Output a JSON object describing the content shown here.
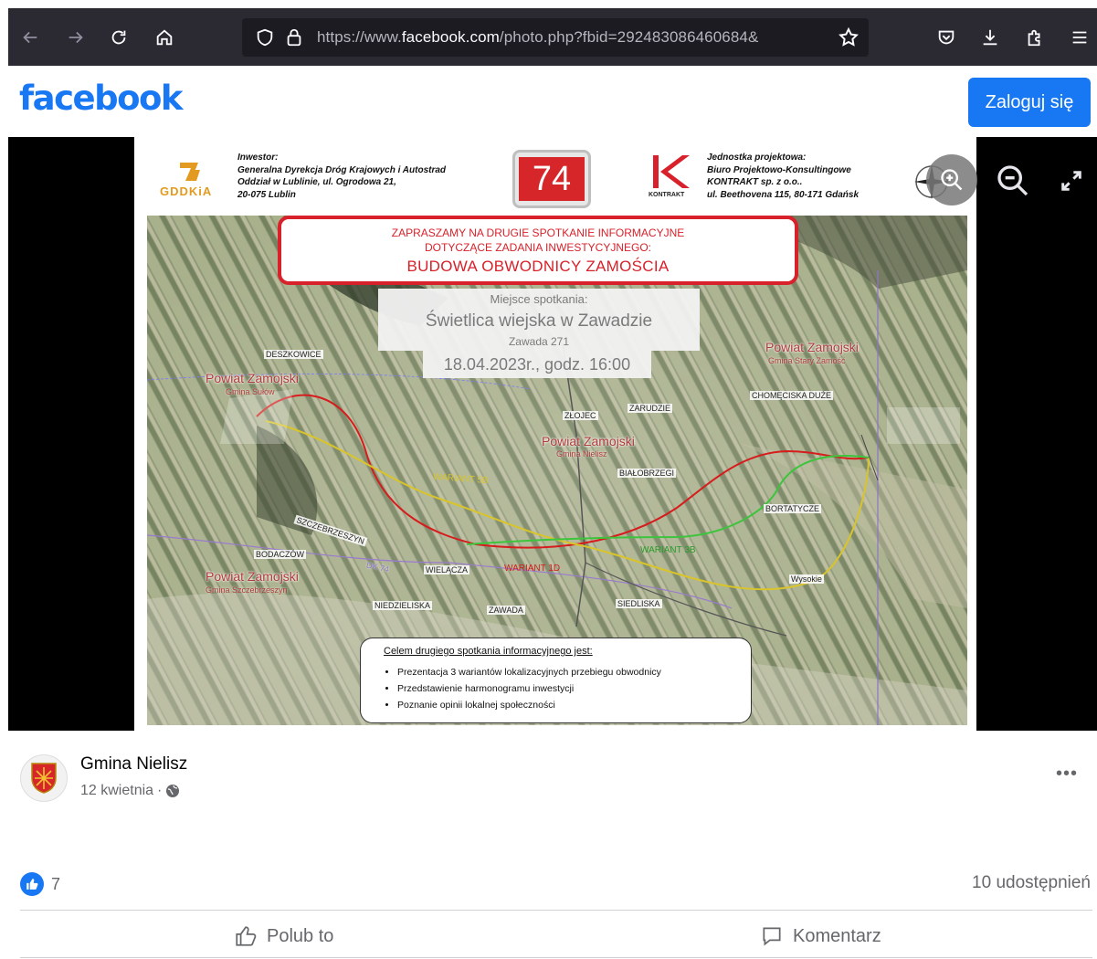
{
  "browser": {
    "url_prefix": "https://www.",
    "url_domain": "facebook.com",
    "url_rest": "/photo.php?fbid=292483086460684&"
  },
  "header": {
    "logo": "facebook",
    "login_label": "Zaloguj się"
  },
  "photo": {
    "gddkia_text": "GDDKiA",
    "investor_title": "Inwestor:",
    "investor_lines": [
      "Generalna Dyrekcja Dróg Krajowych i Autostrad",
      "Oddział w Lublinie, ul. Ogrodowa 21,",
      "20-075 Lublin"
    ],
    "number": "74",
    "kontrakt_text": "KONTRAKT",
    "designer_title": "Jednostka projektowa:",
    "designer_lines": [
      "Biuro Projektowo-Konsultingowe",
      "KONTRAKT sp. z o.o..",
      "ul. Beethovena 115, 80-171 Gdańsk"
    ],
    "banner_line1": "ZAPRASZAMY NA DRUGIE SPOTKANIE INFORMACYJNE",
    "banner_line2": "DOTYCZĄCE ZADANIA INWESTYCYJNEGO:",
    "banner_line3": "BUDOWA OBWODNICY ZAMOŚCIA",
    "place_title": "Miejsce spotkania:",
    "place_name": "Świetlica wiejska w Zawadzie",
    "place_address": "Zawada 271",
    "date": "18.04.2023r., godz. 16:00",
    "map_labels": {
      "deszkowice": "DESZKOWICE",
      "zloiec": "ZŁOJEC",
      "zarudzie": "ZARUDZIE",
      "chomeciska": "CHOMĘCISKA DUŻE",
      "bialobrzegi": "BIAŁOBRZEGI",
      "bortatycze": "BORTATYCZE",
      "szczebrzeszyn": "SZCZEBRZESZYN",
      "bodaczow": "BODACZÓW",
      "wielacza": "WIELĄCZA",
      "wysokie": "Wysokie",
      "niedzieliska": "NIEDZIELISKA",
      "zawada": "ZAWADA",
      "sieduska": "SIEDLISKA",
      "dk74": "DK 74"
    },
    "regions": {
      "r1_title": "Powiat Zamojski",
      "r1_sub": "Gmina Sułów",
      "r2_title": "Powiat Zamojski",
      "r2_sub": "Gmina Stary Zamość",
      "r3_title": "Powiat Zamojski",
      "r3_sub": "Gmina Nielisz",
      "r4_title": "Powiat Zamojski",
      "r4_sub": "Gmina Szczebrzeszyn"
    },
    "variants": {
      "v5": "WARIANT 5B",
      "v1": "WARIANT 1D",
      "v3": "WARIANT 3B"
    },
    "goal_title": "Celem drugiego spotkania informacyjnego jest:",
    "goal_items": [
      "Prezentacja 3 wariantów lokalizacyjnych przebiegu obwodnicy",
      "Przedstawienie harmonogramu inwestycji",
      "Poznanie opinii lokalnej społeczności"
    ]
  },
  "post": {
    "author": "Gmina Nielisz",
    "date": "12 kwietnia",
    "separator": "·",
    "reaction_count": "7",
    "shares": "10 udostępnień",
    "like_label": "Polub to",
    "comment_label": "Komentarz"
  },
  "colors": {
    "accent": "#1877f2",
    "toolbar": "#2b2a33",
    "urlbar": "#1c1b22",
    "banner_red": "#d8212a"
  }
}
